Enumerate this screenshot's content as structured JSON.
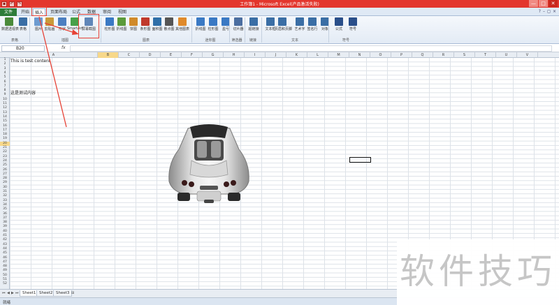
{
  "window": {
    "title": "工作簿1 - Microsoft Excel(产品激活失败)",
    "controls": [
      "—",
      "□",
      "✕"
    ]
  },
  "quick_access": [
    "save-icon",
    "undo-icon",
    "redo-icon"
  ],
  "ribbon_tabs": [
    "文件",
    "开始",
    "插入",
    "页面布局",
    "公式",
    "数据",
    "审阅",
    "视图"
  ],
  "ribbon_buttons": [
    {
      "label": "数据透视表",
      "icon": "pivot-table-icon",
      "color": "#4a8a3a"
    },
    {
      "label": "表格",
      "icon": "table-icon",
      "color": "#3a6ea5"
    },
    {
      "label": "图片",
      "icon": "picture-icon",
      "color": "#6d9bd0"
    },
    {
      "label": "剪贴画",
      "icon": "clipart-icon",
      "color": "#c89a3a"
    },
    {
      "label": "形状",
      "icon": "shapes-icon",
      "color": "#4c7fc1"
    },
    {
      "label": "SmartArt",
      "icon": "smartart-icon",
      "color": "#47a04a"
    },
    {
      "label": "屏幕截图",
      "icon": "screenshot-icon",
      "color": "#5f86b8"
    },
    {
      "label": "柱形图",
      "icon": "column-chart-icon",
      "color": "#3a79c4"
    },
    {
      "label": "折线图",
      "icon": "line-chart-icon",
      "color": "#5a9a3a"
    },
    {
      "label": "饼图",
      "icon": "pie-chart-icon",
      "color": "#d08a2a"
    },
    {
      "label": "条形图",
      "icon": "bar-chart-icon",
      "color": "#c0392b"
    },
    {
      "label": "面积图",
      "icon": "area-chart-icon",
      "color": "#2f6fa8"
    },
    {
      "label": "散点图",
      "icon": "scatter-chart-icon",
      "color": "#555555"
    },
    {
      "label": "其他图表",
      "icon": "other-charts-icon",
      "color": "#e08a2a"
    },
    {
      "label": "折线图",
      "icon": "sparkline-line-icon",
      "color": "#3a79c4"
    },
    {
      "label": "柱形图",
      "icon": "sparkline-column-icon",
      "color": "#3a79c4"
    },
    {
      "label": "盈亏",
      "icon": "winloss-icon",
      "color": "#3a79c4"
    },
    {
      "label": "切片器",
      "icon": "slicer-icon",
      "color": "#4b6ea0"
    },
    {
      "label": "超链接",
      "icon": "hyperlink-icon",
      "color": "#3a6ea5"
    },
    {
      "label": "文本框",
      "icon": "textbox-icon",
      "color": "#3a6ea5"
    },
    {
      "label": "页眉和页脚",
      "icon": "header-footer-icon",
      "color": "#3a6ea5"
    },
    {
      "label": "艺术字",
      "icon": "wordart-icon",
      "color": "#3a6ea5"
    },
    {
      "label": "签名行",
      "icon": "signature-icon",
      "color": "#3a6ea5"
    },
    {
      "label": "对象",
      "icon": "object-icon",
      "color": "#3a6ea5"
    },
    {
      "label": "公式",
      "icon": "equation-icon",
      "color": "#2a4f8a"
    },
    {
      "label": "符号",
      "icon": "symbol-icon",
      "color": "#2a4f8a"
    }
  ],
  "ribbon_groups": [
    "表格",
    "插图",
    "图表",
    "迷你图",
    "筛选器",
    "链接",
    "文本",
    "符号"
  ],
  "formula_bar": {
    "name_box": "B20",
    "fx_label": "fx",
    "value": ""
  },
  "columns": [
    "A",
    "B",
    "C",
    "D",
    "E",
    "F",
    "G",
    "H",
    "I",
    "J",
    "K",
    "L",
    "M",
    "N",
    "O",
    "P",
    "Q",
    "R",
    "S",
    "T",
    "U",
    "V"
  ],
  "rows": [
    "1",
    "2",
    "3",
    "4",
    "5",
    "6",
    "7",
    "8",
    "9",
    "10",
    "11",
    "12",
    "13",
    "14",
    "15",
    "16",
    "17",
    "18",
    "19",
    "20",
    "21",
    "22",
    "23",
    "24",
    "25",
    "26",
    "27",
    "28",
    "29",
    "30",
    "31",
    "32",
    "33",
    "34",
    "35",
    "36",
    "37",
    "38",
    "39",
    "40",
    "41",
    "42",
    "43",
    "44",
    "45",
    "46",
    "47",
    "48",
    "49",
    "50",
    "51",
    "52"
  ],
  "cells": {
    "a1": "This is test content",
    "a7": "这是测试内容"
  },
  "embedded_image": {
    "name": "sports-car-picture"
  },
  "sheet_tabs": [
    "Sheet1",
    "Sheet2",
    "Sheet3"
  ],
  "status": {
    "text": "就绪"
  },
  "watermark": {
    "text": "软件技巧"
  },
  "colors": {
    "title_bar": "#e3362d",
    "file_tab": "#2e7d3a",
    "annotation": "#e64236"
  }
}
